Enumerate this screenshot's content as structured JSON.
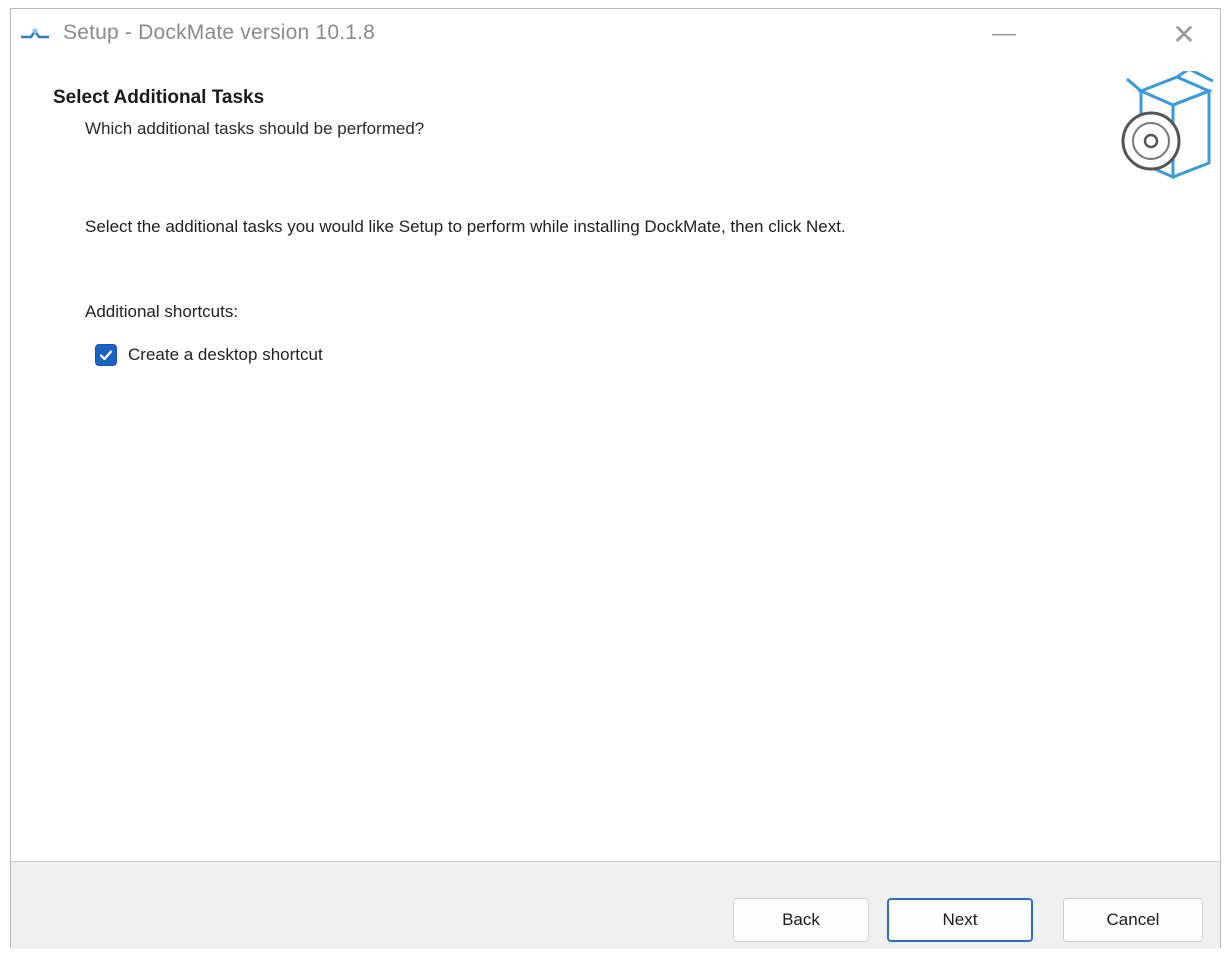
{
  "window": {
    "title": "Setup - DockMate version 10.1.8",
    "controls": {
      "minimize": "—",
      "maximize": "",
      "close": "✕"
    }
  },
  "header": {
    "title": "Select Additional Tasks",
    "subtitle": "Which additional tasks should be performed?",
    "icon": "setup-box-disc-icon"
  },
  "content": {
    "instructions": "Select the additional tasks you would like Setup to perform while installing DockMate, then click Next.",
    "group_label": "Additional shortcuts:",
    "tasks": [
      {
        "label": "Create a desktop shortcut",
        "checked": true
      }
    ]
  },
  "footer": {
    "back_label": "Back",
    "next_label": "Next",
    "cancel_label": "Cancel"
  },
  "colors": {
    "accent": "#1a63c0",
    "focus_border": "#2a6cc4",
    "footer_bg": "#f0f0f0"
  }
}
